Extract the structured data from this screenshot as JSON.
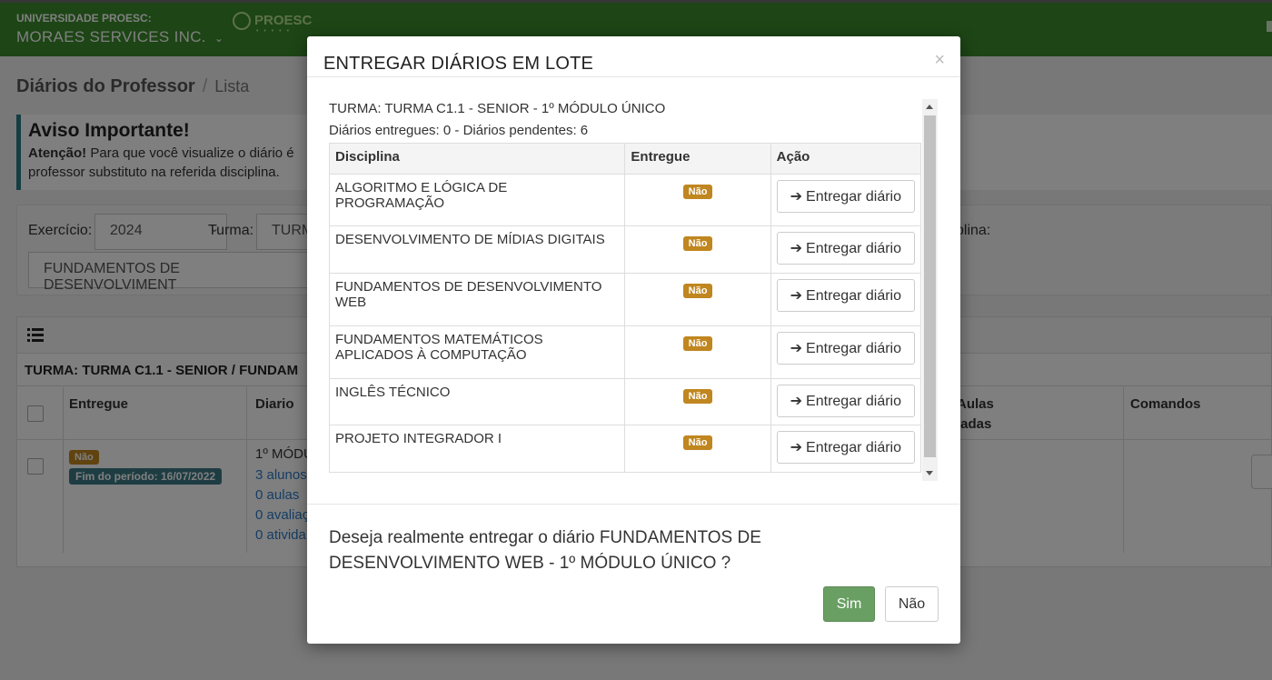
{
  "header": {
    "university": "UNIVERSIDADE PROESC:",
    "company": "MORAES SERVICES INC.",
    "logo_text": "PROESC"
  },
  "page": {
    "title": "Diários do Professor",
    "separator": "/",
    "crumb": "Lista"
  },
  "notice": {
    "title": "Aviso Importante!",
    "attention": "Atenção!",
    "text1": " Para que você visualize o diário é",
    "text2": "professor substituto na referida disciplina."
  },
  "filters": {
    "exercicio_label": "Exercício:",
    "exercicio_value": "2024",
    "turma_label": "Turma:",
    "turma_value": "TURM",
    "disciplina_label": "plina:",
    "disciplina_value": "FUNDAMENTOS DE DESENVOLVIMENT"
  },
  "grid": {
    "group": "TURMA: TURMA C1.1 - SENIOR / FUNDAM",
    "headers": {
      "entregue": "Entregue",
      "diario": "Diario",
      "aulas": "Aulas",
      "aulas2": "ladas",
      "comandos": "Comandos"
    },
    "row": {
      "status": "Não",
      "period": "Fim do período: 16/07/2022",
      "module": "1º MÓDU",
      "alunos": "3 alunos",
      "aulas": "0 aulas",
      "avaliacoes": "0 avaliaç",
      "atividades": "0 ativida"
    }
  },
  "modal": {
    "title": "ENTREGAR DIÁRIOS EM LOTE",
    "close": "×",
    "turma": "TURMA: TURMA C1.1 - SENIOR - 1º MÓDULO ÚNICO",
    "status_summary": "Diários entregues: 0 - Diários pendentes: 6",
    "columns": [
      "Disciplina",
      "Entregue",
      "Ação"
    ],
    "rows": [
      {
        "disciplina": "ALGORITMO E LÓGICA DE PROGRAMAÇÃO",
        "entregue": "Não",
        "acao": "Entregar diário"
      },
      {
        "disciplina": "DESENVOLVIMENTO DE MÍDIAS DIGITAIS",
        "entregue": "Não",
        "acao": "Entregar diário"
      },
      {
        "disciplina": "FUNDAMENTOS DE DESENVOLVIMENTO WEB",
        "entregue": "Não",
        "acao": "Entregar diário"
      },
      {
        "disciplina": "FUNDAMENTOS MATEMÁTICOS APLICADOS À COMPUTAÇÃO",
        "entregue": "Não",
        "acao": "Entregar diário"
      },
      {
        "disciplina": "INGLÊS TÉCNICO",
        "entregue": "Não",
        "acao": "Entregar diário"
      },
      {
        "disciplina": "PROJETO INTEGRADOR I",
        "entregue": "Não",
        "acao": "Entregar diário"
      }
    ],
    "confirm": "Deseja realmente entregar o diário FUNDAMENTOS DE DESENVOLVIMENTO WEB - 1º MÓDULO ÚNICO ?",
    "yes": "Sim",
    "no": "Não"
  },
  "colors": {
    "header_green": "#3a8a2b",
    "badge_orange": "#c0861f",
    "badge_teal": "#3d7a86",
    "button_green": "#6a9f63"
  },
  "icons": [
    "chevron-down-icon",
    "list-icon",
    "arrow-right-icon",
    "close-icon",
    "logo-icon"
  ]
}
